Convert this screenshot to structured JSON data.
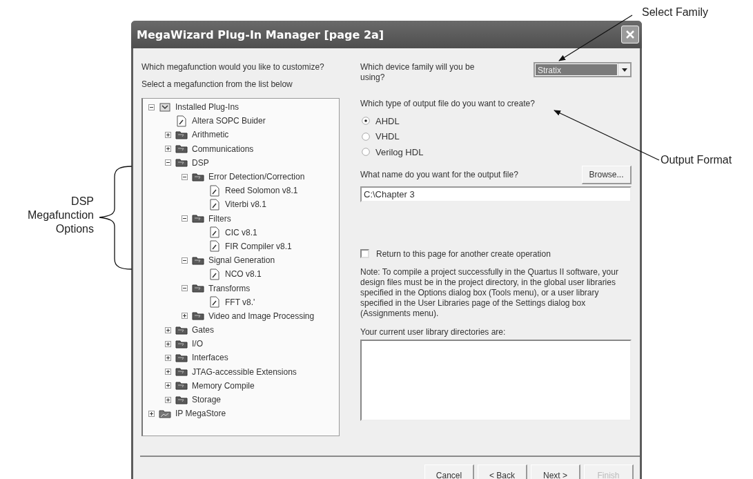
{
  "window": {
    "title": "MegaWizard Plug-In Manager [page 2a]"
  },
  "left": {
    "question": "Which megafunction would you like to customize?",
    "hint": "Select a megafunction from the list below"
  },
  "tree": [
    {
      "label": "Installed Plug-Ins",
      "kind": "root",
      "expanded": true,
      "children": [
        {
          "label": "Altera SOPC Buider",
          "kind": "plugin"
        },
        {
          "label": "Arithmetic",
          "kind": "folder",
          "expanded": false
        },
        {
          "label": "Communications",
          "kind": "folder",
          "expanded": false
        },
        {
          "label": "DSP",
          "kind": "folder",
          "expanded": true,
          "children": [
            {
              "label": "Error Detection/Correction",
              "kind": "folder",
              "expanded": true,
              "children": [
                {
                  "label": "Reed Solomon v8.1",
                  "kind": "plugin"
                },
                {
                  "label": "Viterbi v8.1",
                  "kind": "plugin"
                }
              ]
            },
            {
              "label": "Filters",
              "kind": "folder",
              "expanded": true,
              "children": [
                {
                  "label": "CIC v8.1",
                  "kind": "plugin"
                },
                {
                  "label": "FIR Compiler v8.1",
                  "kind": "plugin"
                }
              ]
            },
            {
              "label": "Signal Generation",
              "kind": "folder",
              "expanded": true,
              "children": [
                {
                  "label": "NCO v8.1",
                  "kind": "plugin"
                }
              ]
            },
            {
              "label": "Transforms",
              "kind": "folder",
              "expanded": true,
              "children": [
                {
                  "label": "FFT v8.'",
                  "kind": "plugin"
                }
              ]
            },
            {
              "label": "Video and Image Processing",
              "kind": "folder",
              "expanded": false
            }
          ]
        },
        {
          "label": "Gates",
          "kind": "folder",
          "expanded": false
        },
        {
          "label": "I/O",
          "kind": "folder",
          "expanded": false
        },
        {
          "label": "Interfaces",
          "kind": "folder",
          "expanded": false
        },
        {
          "label": "JTAG-accessible Extensions",
          "kind": "folder",
          "expanded": false
        },
        {
          "label": "Memory Compile",
          "kind": "folder",
          "expanded": false
        },
        {
          "label": "Storage",
          "kind": "folder",
          "expanded": false
        }
      ]
    },
    {
      "label": "IP MegaStore",
      "kind": "store",
      "expanded": false
    }
  ],
  "family": {
    "question": "Which device family will you be using?",
    "value": "Stratix"
  },
  "output_type": {
    "question": "Which type of output file do you want to create?",
    "options": [
      {
        "label": "AHDL",
        "selected": true
      },
      {
        "label": "VHDL",
        "selected": false
      },
      {
        "label": "Verilog HDL",
        "selected": false
      }
    ]
  },
  "output_name": {
    "question": "What name do you want for the output file?",
    "browse": "Browse...",
    "value": "C:\\Chapter 3"
  },
  "return_option": {
    "label": "Return to this page for another create operation",
    "checked": false
  },
  "note": "Note: To compile a project successfully in the Quartus II software, your design files must be in the project directory, in the global user libraries specified in the Options dialog box (Tools menu), or a user library specified in the User Libraries page of the Settings dialog box (Assignments menu).",
  "libraries": {
    "label": "Your current user library directories are:"
  },
  "buttons": [
    {
      "label": "Cancel",
      "disabled": false
    },
    {
      "label": "< Back",
      "disabled": false
    },
    {
      "label": "Next >",
      "disabled": false
    },
    {
      "label": "Finish",
      "disabled": true
    }
  ],
  "callouts": [
    {
      "text": "Select Family"
    },
    {
      "text": "Output Format"
    },
    {
      "text": "DSP Megafunction Options"
    }
  ]
}
